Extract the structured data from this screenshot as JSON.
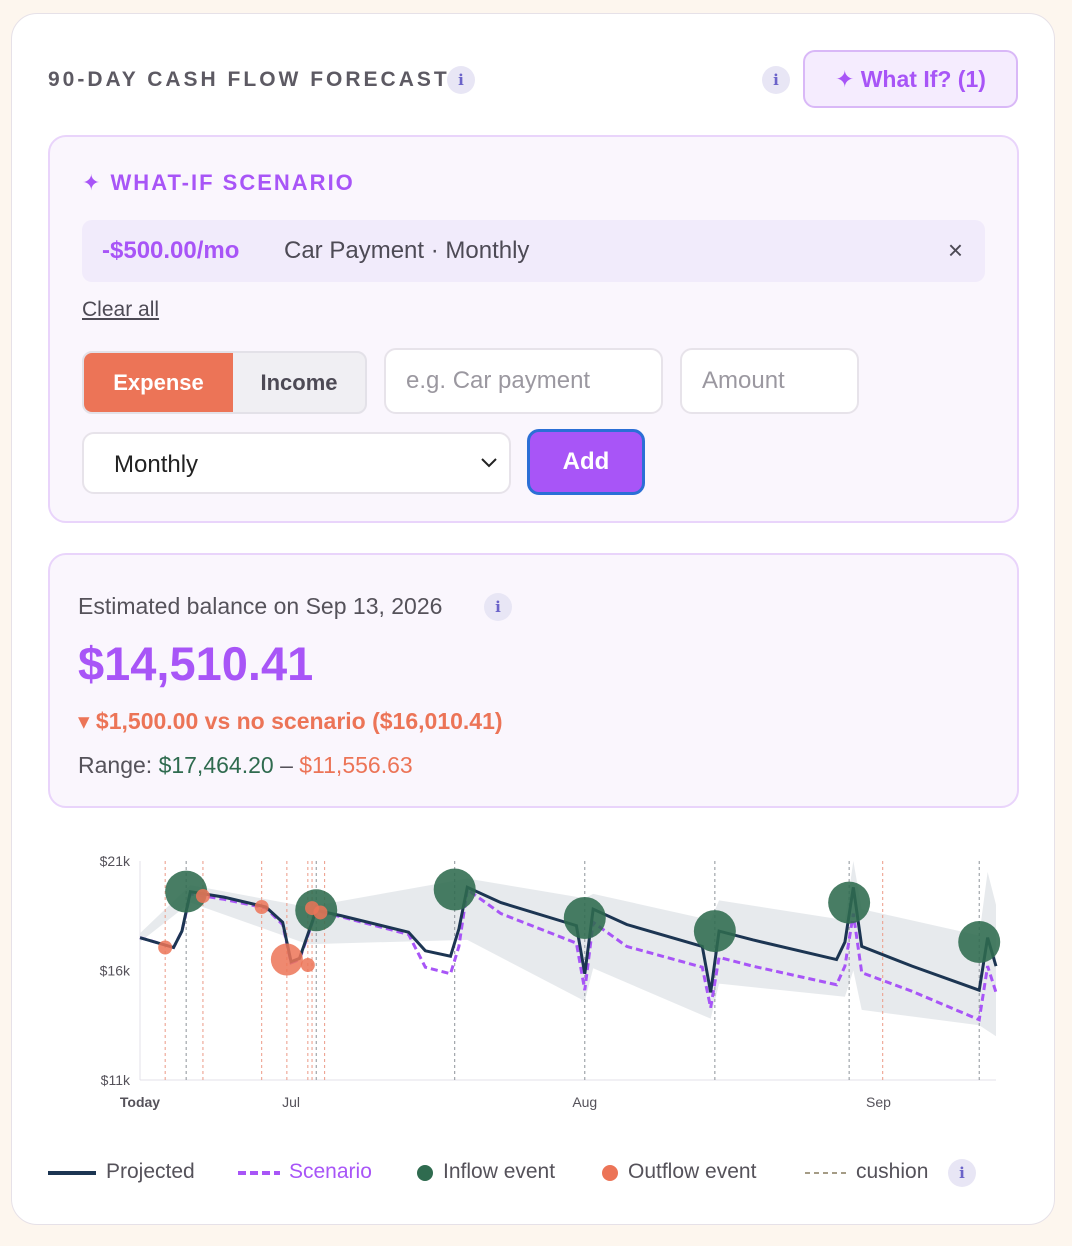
{
  "header": {
    "title": "90-DAY CASH FLOW FORECAST",
    "whatif_label": "✦ What If? (1)"
  },
  "info_glyph": "i",
  "scenario": {
    "title": "✦ WHAT-IF SCENARIO",
    "item": {
      "amount": "-$500.00/mo",
      "desc": "Car Payment · Monthly",
      "remove": "×"
    },
    "clear_all": "Clear all",
    "toggle": {
      "expense": "Expense",
      "income": "Income",
      "selected": "Expense"
    },
    "name_placeholder": "e.g. Car payment",
    "amount_placeholder": "Amount",
    "frequency": "Monthly",
    "add_label": "Add"
  },
  "estimate": {
    "label": "Estimated balance on Sep 13, 2026",
    "value": "$14,510.41",
    "delta": "▾ $1,500.00 vs no scenario ($16,010.41)",
    "range_label": "Range:",
    "range_high": "$17,464.20",
    "range_sep": "–",
    "range_low": "$11,556.63"
  },
  "chart_data": {
    "type": "line",
    "y_ticks": [
      "$21k",
      "$16k",
      "$11k"
    ],
    "ylim": [
      11000,
      21000
    ],
    "x_ticks": [
      {
        "label": "Today",
        "day": 0
      },
      {
        "label": "Jul",
        "day": 18
      },
      {
        "label": "Aug",
        "day": 53
      },
      {
        "label": "Sep",
        "day": 88
      }
    ],
    "days": 102,
    "projected": [
      [
        0,
        17500
      ],
      [
        4,
        17050
      ],
      [
        5,
        17800
      ],
      [
        6,
        19600
      ],
      [
        10,
        19350
      ],
      [
        15,
        18900
      ],
      [
        17,
        18200
      ],
      [
        18,
        16400
      ],
      [
        19,
        16550
      ],
      [
        21,
        18750
      ],
      [
        24,
        18500
      ],
      [
        32,
        17750
      ],
      [
        34,
        16900
      ],
      [
        37,
        16650
      ],
      [
        38,
        17900
      ],
      [
        39,
        19800
      ],
      [
        43,
        19100
      ],
      [
        52,
        18050
      ],
      [
        53,
        15850
      ],
      [
        54,
        18800
      ],
      [
        58,
        18100
      ],
      [
        67,
        17100
      ],
      [
        68,
        15000
      ],
      [
        69,
        17800
      ],
      [
        73,
        17400
      ],
      [
        83,
        16500
      ],
      [
        84,
        17300
      ],
      [
        85,
        19800
      ],
      [
        86,
        17100
      ],
      [
        92,
        16200
      ],
      [
        100,
        15100
      ],
      [
        101,
        17500
      ],
      [
        102,
        16200
      ]
    ],
    "scenario": [
      [
        0,
        17500
      ],
      [
        4,
        17050
      ],
      [
        5,
        17800
      ],
      [
        6,
        19500
      ],
      [
        10,
        19250
      ],
      [
        15,
        18850
      ],
      [
        17,
        18100
      ],
      [
        18,
        16350
      ],
      [
        19,
        16500
      ],
      [
        21,
        18700
      ],
      [
        24,
        18450
      ],
      [
        32,
        17650
      ],
      [
        34,
        16150
      ],
      [
        37,
        15850
      ],
      [
        38,
        17100
      ],
      [
        39,
        19700
      ],
      [
        43,
        18600
      ],
      [
        52,
        17250
      ],
      [
        53,
        15100
      ],
      [
        54,
        18200
      ],
      [
        58,
        17100
      ],
      [
        67,
        16150
      ],
      [
        68,
        14300
      ],
      [
        69,
        16600
      ],
      [
        73,
        16200
      ],
      [
        83,
        15350
      ],
      [
        84,
        16200
      ],
      [
        85,
        18600
      ],
      [
        86,
        15900
      ],
      [
        92,
        15050
      ],
      [
        100,
        13750
      ],
      [
        101,
        16200
      ],
      [
        102,
        15000
      ]
    ],
    "band_upper": [
      [
        0,
        17700
      ],
      [
        6,
        19900
      ],
      [
        20,
        18900
      ],
      [
        39,
        20200
      ],
      [
        53,
        19300
      ],
      [
        54,
        19500
      ],
      [
        68,
        18300
      ],
      [
        69,
        19200
      ],
      [
        84,
        18300
      ],
      [
        85,
        21000
      ],
      [
        86,
        18800
      ],
      [
        100,
        17600
      ],
      [
        101,
        20500
      ],
      [
        102,
        19000
      ]
    ],
    "band_lower": [
      [
        102,
        13000
      ],
      [
        100,
        13500
      ],
      [
        86,
        14200
      ],
      [
        85,
        16000
      ],
      [
        84,
        14800
      ],
      [
        69,
        15400
      ],
      [
        68,
        13800
      ],
      [
        54,
        16100
      ],
      [
        53,
        14600
      ],
      [
        39,
        17400
      ],
      [
        20,
        17200
      ],
      [
        6,
        19100
      ],
      [
        0,
        17300
      ]
    ],
    "inflow_events": [
      {
        "day": 5.5,
        "value": 19600,
        "size": "large"
      },
      {
        "day": 21,
        "value": 18750,
        "size": "large"
      },
      {
        "day": 37.5,
        "value": 19700,
        "size": "large"
      },
      {
        "day": 53,
        "value": 18400,
        "size": "large"
      },
      {
        "day": 68.5,
        "value": 17800,
        "size": "large"
      },
      {
        "day": 84.5,
        "value": 19100,
        "size": "large"
      },
      {
        "day": 100,
        "value": 17300,
        "size": "large"
      }
    ],
    "outflow_events": [
      {
        "day": 3,
        "value": 17050,
        "size": "small"
      },
      {
        "day": 7.5,
        "value": 19400,
        "size": "small"
      },
      {
        "day": 14.5,
        "value": 18900,
        "size": "small"
      },
      {
        "day": 17.5,
        "value": 16500,
        "size": "large"
      },
      {
        "day": 20,
        "value": 16250,
        "size": "small"
      },
      {
        "day": 20.5,
        "value": 18850,
        "size": "small"
      },
      {
        "day": 21.5,
        "value": 18650,
        "size": "small"
      }
    ],
    "cushion_days": [
      3,
      7.5,
      14.5,
      17.5,
      20,
      20.5,
      22,
      88.5
    ],
    "event_lines": [
      5.5,
      21,
      37.5,
      53,
      68.5,
      84.5,
      100
    ],
    "colors": {
      "projected": "#1c3552",
      "scenario": "#a855f7",
      "inflow": "#2f6b4f",
      "outflow": "#ec7457",
      "band": "#dfe3e7"
    }
  },
  "legend": {
    "projected": "Projected",
    "scenario": "Scenario",
    "inflow": "Inflow event",
    "outflow": "Outflow event",
    "cushion": "cushion"
  }
}
